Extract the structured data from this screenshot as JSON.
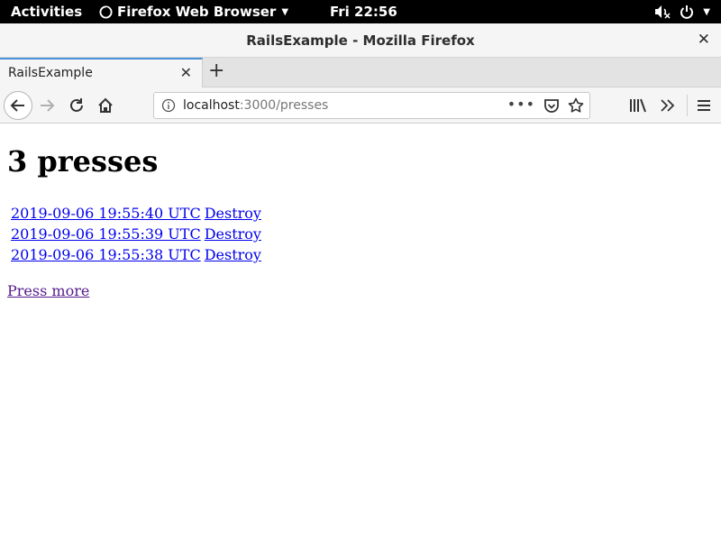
{
  "topbar": {
    "activities": "Activities",
    "app_name": "Firefox Web Browser",
    "clock": "Fri 22:56"
  },
  "window": {
    "title": "RailsExample - Mozilla Firefox"
  },
  "tabs": [
    {
      "label": "RailsExample",
      "active": true
    }
  ],
  "urlbar": {
    "host": "localhost",
    "path": ":3000/presses"
  },
  "page": {
    "heading": "3 presses",
    "rows": [
      {
        "timestamp": "2019-09-06 19:55:40 UTC",
        "action": "Destroy"
      },
      {
        "timestamp": "2019-09-06 19:55:39 UTC",
        "action": "Destroy"
      },
      {
        "timestamp": "2019-09-06 19:55:38 UTC",
        "action": "Destroy"
      }
    ],
    "more_link": "Press more"
  },
  "icons": {
    "app": "firefox-icon",
    "volume": "volume-muted-icon",
    "power": "power-icon",
    "back": "back-arrow-icon",
    "forward": "forward-arrow-icon",
    "reload": "reload-icon",
    "home": "home-icon",
    "info": "info-icon",
    "pocket": "pocket-icon",
    "bookmark": "star-icon",
    "library": "library-icon",
    "overflow": "overflow-chevron-icon",
    "menu": "hamburger-menu-icon"
  },
  "colors": {
    "link": "#0000ee",
    "visited_link": "#551a8b",
    "tab_accent": "#4a90d9"
  }
}
